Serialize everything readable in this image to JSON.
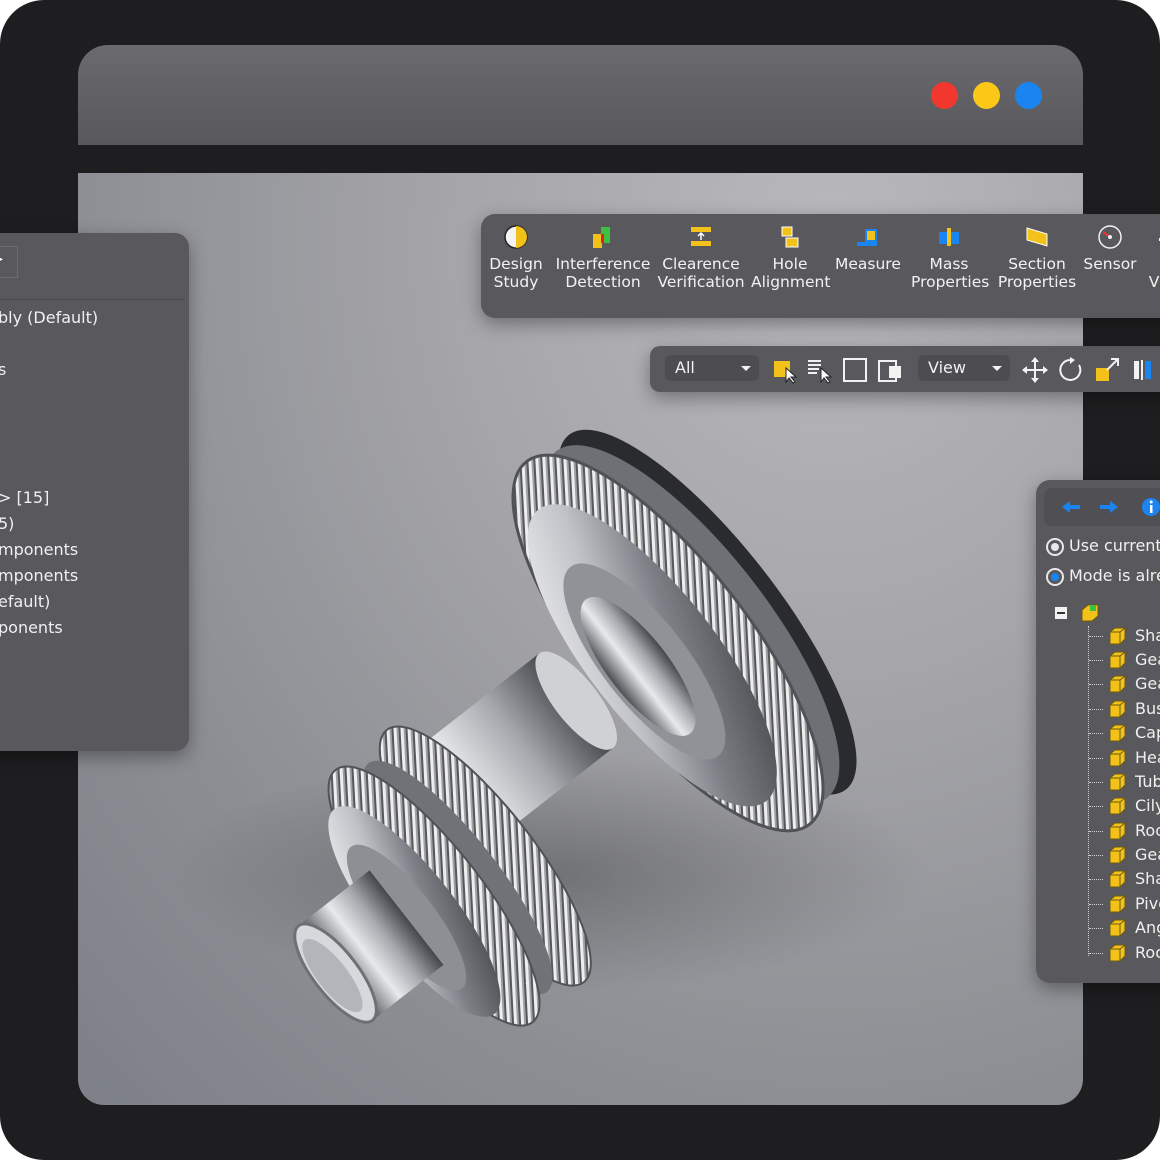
{
  "window": {
    "controls": [
      "close-dot",
      "minimize-dot",
      "maximize-dot"
    ],
    "control_colors": [
      "#f2382e",
      "#fbc817",
      "#1a84f0"
    ]
  },
  "left_panel": {
    "rows": [
      "bly (Default)",
      "s",
      "> [15]",
      "5)",
      "mponents",
      "mponents",
      "efault)",
      "ponents"
    ]
  },
  "toolbar": {
    "items": [
      {
        "label1": "Design",
        "label2": "Study",
        "icon": "design-study-icon"
      },
      {
        "label1": "Interference",
        "label2": "Detection",
        "icon": "interference-detection-icon"
      },
      {
        "label1": "Clearence",
        "label2": "Verification",
        "icon": "clearence-verification-icon"
      },
      {
        "label1": "Hole",
        "label2": "Alignment",
        "icon": "hole-alignment-icon"
      },
      {
        "label1": "Measure",
        "label2": "",
        "icon": "measure-icon"
      },
      {
        "label1": "Mass",
        "label2": "Properties",
        "icon": "mass-properties-icon"
      },
      {
        "label1": "Section",
        "label2": "Properties",
        "icon": "section-properties-icon"
      },
      {
        "label1": "Sensor",
        "label2": "",
        "icon": "sensor-icon"
      },
      {
        "label1": "",
        "label2": "Vi",
        "icon": "partial-tool-icon"
      }
    ]
  },
  "selection_bar": {
    "filter_value": "All",
    "view_value": "View"
  },
  "right_panel": {
    "option1": "Use current",
    "option2": "Mode is alre",
    "tree_items": [
      "Sha",
      "Gea",
      "Gea",
      "Bus",
      "Cap",
      "Hea",
      "Tub",
      "Cily",
      "Roc",
      "Gea",
      "Sha",
      "Pive",
      "Ang",
      "Roc"
    ]
  },
  "colors": {
    "accent_blue": "#1a84f0",
    "icon_yellow": "#f2c21b",
    "panel_bg": "#59595d"
  }
}
